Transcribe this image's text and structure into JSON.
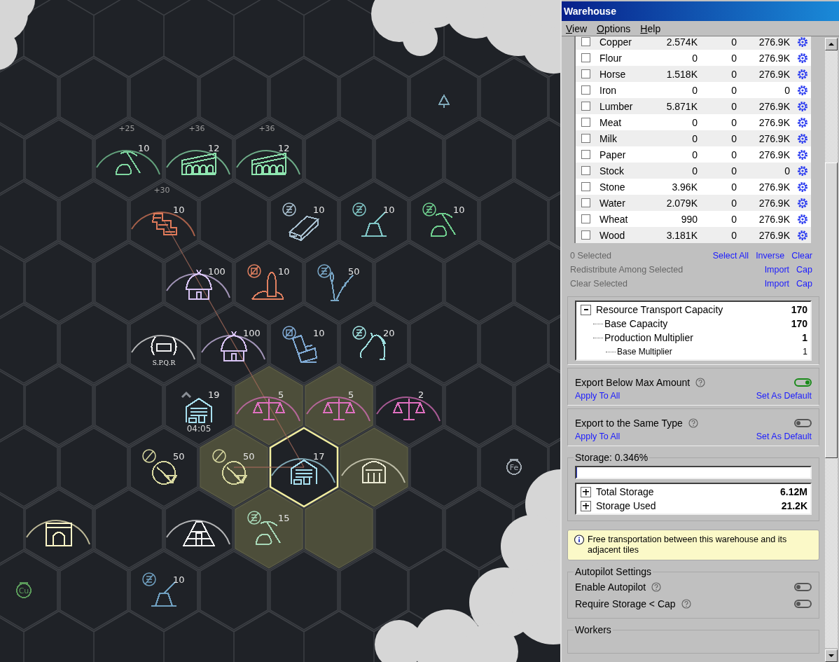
{
  "map": {
    "rows": [
      [
        {
          "kind": "empty",
          "ring": false,
          "highlighted": false,
          "selected": false,
          "linked": false
        },
        {
          "kind": "empty",
          "ring": false,
          "highlighted": false,
          "selected": false,
          "linked": false
        },
        {
          "kind": "empty",
          "ring": false,
          "highlighted": false,
          "selected": false,
          "linked": false
        },
        {
          "kind": "empty",
          "ring": false,
          "highlighted": false,
          "selected": false,
          "linked": false
        },
        {
          "kind": "empty",
          "ring": false,
          "highlighted": false,
          "selected": false,
          "linked": false
        },
        {
          "kind": "empty",
          "ring": false,
          "highlighted": false,
          "selected": false,
          "linked": false
        },
        {
          "kind": "tree",
          "color": "#7fa8b8",
          "ring": false,
          "highlighted": false,
          "selected": false,
          "linked": false
        },
        {
          "kind": "empty",
          "ring": false,
          "highlighted": false,
          "selected": false,
          "linked": false
        }
      ],
      [
        {
          "kind": "empty",
          "ring": false,
          "highlighted": false,
          "selected": false,
          "linked": false
        },
        {
          "kind": "pickaxe",
          "color": "#7fd6a0",
          "count": "10",
          "bonus": "+25",
          "ring": true,
          "highlighted": false,
          "selected": false,
          "linked": false
        },
        {
          "kind": "aqueduct",
          "color": "#8fe6b0",
          "count": "12",
          "bonus": "+36",
          "ring": true,
          "highlighted": false,
          "selected": false,
          "linked": false
        },
        {
          "kind": "aqueduct",
          "color": "#8fe6b0",
          "count": "12",
          "bonus": "+36",
          "ring": true,
          "highlighted": false,
          "selected": false,
          "linked": false
        },
        {
          "kind": "empty",
          "ring": false,
          "highlighted": false,
          "selected": false,
          "linked": false
        },
        {
          "kind": "empty",
          "ring": false,
          "highlighted": false,
          "selected": false,
          "linked": false
        },
        {
          "kind": "empty",
          "ring": false,
          "highlighted": false,
          "selected": false,
          "linked": false
        },
        {
          "kind": "empty",
          "ring": false,
          "highlighted": false,
          "selected": false,
          "linked": false
        }
      ],
      [
        {
          "kind": "empty",
          "ring": false,
          "highlighted": false,
          "selected": false,
          "linked": false
        },
        {
          "kind": "empty",
          "ring": false,
          "highlighted": false,
          "selected": false,
          "linked": false
        },
        {
          "kind": "bricks",
          "color": "#e07a5a",
          "count": "10",
          "bonus": "+30",
          "ring": true,
          "highlighted": false,
          "selected": false,
          "linked": true
        },
        {
          "kind": "empty",
          "ring": false,
          "highlighted": false,
          "selected": false,
          "linked": false
        },
        {
          "kind": "lumber",
          "color": "#a8c0d0",
          "count": "10",
          "badge": {
            "kind": "coins"
          },
          "ring": false,
          "highlighted": false,
          "selected": false,
          "linked": false
        },
        {
          "kind": "stump",
          "color": "#7fc4c4",
          "count": "10",
          "badge": {
            "kind": "coins"
          },
          "ring": false,
          "highlighted": false,
          "selected": false,
          "linked": false
        },
        {
          "kind": "pickaxe",
          "color": "#6fcf8f",
          "count": "10",
          "badge": {
            "kind": "coins"
          },
          "ring": false,
          "highlighted": false,
          "selected": false,
          "linked": false
        },
        {
          "kind": "empty",
          "ring": false,
          "highlighted": false,
          "selected": false,
          "linked": false
        }
      ],
      [
        {
          "kind": "empty",
          "ring": false,
          "highlighted": false,
          "selected": false,
          "linked": false
        },
        {
          "kind": "empty",
          "ring": false,
          "highlighted": false,
          "selected": false,
          "linked": false
        },
        {
          "kind": "hut",
          "color": "#d8c4f4",
          "count": "100",
          "ring": true,
          "highlighted": false,
          "selected": false,
          "linked": false
        },
        {
          "kind": "tower",
          "color": "#e08060",
          "count": "10",
          "badge": {
            "kind": "crate"
          },
          "ring": false,
          "highlighted": false,
          "selected": false,
          "linked": false
        },
        {
          "kind": "wheat",
          "color": "#7aa8c8",
          "count": "50",
          "badge": {
            "kind": "coins"
          },
          "ring": false,
          "highlighted": false,
          "selected": false,
          "linked": false
        },
        {
          "kind": "empty",
          "ring": false,
          "highlighted": false,
          "selected": false,
          "linked": false
        },
        {
          "kind": "empty",
          "ring": false,
          "highlighted": false,
          "selected": false,
          "linked": false
        },
        {
          "kind": "empty",
          "ring": false,
          "highlighted": false,
          "selected": false,
          "linked": false
        }
      ],
      [
        {
          "kind": "empty",
          "ring": false,
          "highlighted": false,
          "selected": false,
          "linked": false
        },
        {
          "kind": "empty",
          "ring": false,
          "highlighted": false,
          "selected": false,
          "linked": false
        },
        {
          "kind": "laurel",
          "color": "#f4f4f4",
          "label": "S.P.Q.R",
          "ring": true,
          "highlighted": false,
          "selected": false,
          "linked": false
        },
        {
          "kind": "hut",
          "color": "#d8c4f4",
          "count": "100",
          "ring": true,
          "highlighted": false,
          "selected": false,
          "linked": false
        },
        {
          "kind": "blocks",
          "color": "#80aad4",
          "count": "10",
          "badge": {
            "kind": "crate"
          },
          "ring": false,
          "highlighted": false,
          "selected": false,
          "linked": false
        },
        {
          "kind": "horse",
          "color": "#9fe0e0",
          "count": "20",
          "badge": {
            "kind": "coins"
          },
          "ring": false,
          "highlighted": false,
          "selected": false,
          "linked": false
        },
        {
          "kind": "empty",
          "ring": false,
          "highlighted": false,
          "selected": false,
          "linked": false
        },
        {
          "kind": "empty",
          "ring": false,
          "highlighted": false,
          "selected": false,
          "linked": false
        }
      ],
      [
        {
          "kind": "empty",
          "ring": false,
          "highlighted": false,
          "selected": false,
          "linked": false
        },
        {
          "kind": "empty",
          "ring": false,
          "highlighted": false,
          "selected": false,
          "linked": false
        },
        {
          "kind": "warehouse",
          "color": "#a8e0f0",
          "count": "19",
          "timer": "04:05",
          "ring": false,
          "highlighted": false,
          "selected": false,
          "linked": false
        },
        {
          "kind": "scales",
          "color": "#e070c0",
          "count": "5",
          "ring": true,
          "highlighted": true,
          "selected": false,
          "linked": false
        },
        {
          "kind": "scales",
          "color": "#e070c0",
          "count": "5",
          "ring": true,
          "highlighted": true,
          "selected": false,
          "linked": false
        },
        {
          "kind": "scales",
          "color": "#e070c0",
          "count": "2",
          "ring": true,
          "highlighted": false,
          "selected": false,
          "linked": false
        },
        {
          "kind": "empty",
          "ring": false,
          "highlighted": false,
          "selected": false,
          "linked": false
        },
        {
          "kind": "empty",
          "ring": false,
          "highlighted": false,
          "selected": false,
          "linked": false
        }
      ],
      [
        {
          "kind": "empty",
          "ring": false,
          "highlighted": false,
          "selected": false,
          "linked": false
        },
        {
          "kind": "empty",
          "ring": false,
          "highlighted": false,
          "selected": false,
          "linked": false
        },
        {
          "kind": "broom",
          "color": "#d8d8a0",
          "count": "50",
          "badge": {
            "kind": "prohibited"
          },
          "ring": false,
          "highlighted": false,
          "selected": false,
          "linked": false
        },
        {
          "kind": "broom",
          "color": "#d8d8a0",
          "count": "50",
          "badge": {
            "kind": "prohibited"
          },
          "ring": false,
          "highlighted": true,
          "selected": false,
          "linked": true
        },
        {
          "kind": "warehouse",
          "color": "#a8e0f0",
          "count": "17",
          "ring": true,
          "highlighted": false,
          "selected": true,
          "linked": false
        },
        {
          "kind": "temple",
          "color": "#ecebd4",
          "ring": true,
          "highlighted": true,
          "selected": false,
          "linked": false
        },
        {
          "kind": "empty",
          "ring": false,
          "highlighted": false,
          "selected": false,
          "linked": false
        },
        {
          "kind": "deposit",
          "color": "#a0a8b0",
          "label": "Fe",
          "ring": false,
          "highlighted": false,
          "selected": false,
          "linked": false
        }
      ],
      [
        {
          "kind": "gate",
          "color": "#fff8c8",
          "ring": true,
          "highlighted": false,
          "selected": false,
          "linked": false
        },
        {
          "kind": "empty",
          "ring": false,
          "highlighted": false,
          "selected": false,
          "linked": false
        },
        {
          "kind": "pyramid",
          "color": "#f4f4f4",
          "ring": true,
          "highlighted": false,
          "selected": false,
          "linked": false
        },
        {
          "kind": "pickaxe",
          "color": "#a8d8b8",
          "count": "15",
          "badge": {
            "kind": "coins"
          },
          "ring": false,
          "highlighted": true,
          "selected": false,
          "linked": false
        },
        {
          "kind": "empty",
          "ring": false,
          "highlighted": true,
          "selected": false,
          "linked": false
        },
        {
          "kind": "empty",
          "ring": false,
          "highlighted": false,
          "selected": false,
          "linked": false
        },
        {
          "kind": "empty",
          "ring": false,
          "highlighted": false,
          "selected": false,
          "linked": false
        }
      ],
      [
        {
          "kind": "deposit",
          "color": "#5a9a5a",
          "label": "Cu",
          "ring": false,
          "highlighted": false,
          "selected": false,
          "linked": false
        },
        {
          "kind": "empty",
          "ring": false,
          "highlighted": false,
          "selected": false,
          "linked": false
        },
        {
          "kind": "stump",
          "color": "#6f9fbf",
          "count": "10",
          "badge": {
            "kind": "coins"
          },
          "ring": false,
          "highlighted": false,
          "selected": false,
          "linked": false
        },
        {
          "kind": "empty",
          "ring": false,
          "highlighted": false,
          "selected": false,
          "linked": false
        },
        {
          "kind": "empty",
          "ring": false,
          "highlighted": false,
          "selected": false,
          "linked": false
        },
        {
          "kind": "empty",
          "ring": false,
          "highlighted": false,
          "selected": false,
          "linked": false
        }
      ]
    ]
  },
  "window": {
    "title": "Warehouse",
    "menu": [
      "View",
      "Options",
      "Help"
    ]
  },
  "resources": [
    {
      "name": "Copper",
      "amount": "2.574K",
      "column_3": "0",
      "cap": "276.9K",
      "checked": false
    },
    {
      "name": "Flour",
      "amount": "0",
      "column_3": "0",
      "cap": "276.9K",
      "checked": false
    },
    {
      "name": "Horse",
      "amount": "1.518K",
      "column_3": "0",
      "cap": "276.9K",
      "checked": false
    },
    {
      "name": "Iron",
      "amount": "0",
      "column_3": "0",
      "cap": "0",
      "checked": false
    },
    {
      "name": "Lumber",
      "amount": "5.871K",
      "column_3": "0",
      "cap": "276.9K",
      "checked": false
    },
    {
      "name": "Meat",
      "amount": "0",
      "column_3": "0",
      "cap": "276.9K",
      "checked": false
    },
    {
      "name": "Milk",
      "amount": "0",
      "column_3": "0",
      "cap": "276.9K",
      "checked": false
    },
    {
      "name": "Paper",
      "amount": "0",
      "column_3": "0",
      "cap": "276.9K",
      "checked": false
    },
    {
      "name": "Stock",
      "amount": "0",
      "column_3": "0",
      "cap": "0",
      "checked": false
    },
    {
      "name": "Stone",
      "amount": "3.96K",
      "column_3": "0",
      "cap": "276.9K",
      "checked": false
    },
    {
      "name": "Water",
      "amount": "2.079K",
      "column_3": "0",
      "cap": "276.9K",
      "checked": false
    },
    {
      "name": "Wheat",
      "amount": "990",
      "column_3": "0",
      "cap": "276.9K",
      "checked": false
    },
    {
      "name": "Wood",
      "amount": "3.181K",
      "column_3": "0",
      "cap": "276.9K",
      "checked": false
    }
  ],
  "selection_rows": [
    {
      "label": "0 Selected",
      "links": [
        "Select All",
        "Inverse",
        "Clear"
      ]
    },
    {
      "label": "Redistribute Among Selected",
      "links": [
        "Import",
        "Cap"
      ]
    },
    {
      "label": "Clear Selected",
      "links": [
        "Import",
        "Cap"
      ]
    }
  ],
  "capacity_tree": [
    {
      "label": "Resource Transport Capacity",
      "value": "170",
      "expanded": true,
      "children": [
        {
          "label": "Base Capacity",
          "value": "170"
        },
        {
          "label": "Production Multiplier",
          "value": "1",
          "children": [
            {
              "label": "Base Multiplier",
              "value": "1"
            }
          ]
        }
      ]
    }
  ],
  "export_settings": [
    {
      "label": "Export Below Max Amount",
      "on": true,
      "apply_link": "Apply To All",
      "default_link": "Set As Default"
    },
    {
      "label": "Export to the Same Type",
      "on": false,
      "apply_link": "Apply To All",
      "default_link": "Set As Default"
    }
  ],
  "storage": {
    "title": "Storage: 0.346%",
    "level": 0.00346,
    "tree": [
      {
        "label": "Total Storage",
        "value": "6.12M",
        "expanded": false
      },
      {
        "label": "Storage Used",
        "value": "21.2K",
        "expanded": false
      }
    ]
  },
  "note": "Free transportation between this warehouse and its adjacent tiles",
  "autopilot": {
    "title": "Autopilot Settings",
    "settings": [
      {
        "label": "Enable Autopilot",
        "on": false
      },
      {
        "label": "Require Storage < Cap",
        "on": false
      }
    ]
  },
  "workers": {
    "title": "Workers"
  }
}
